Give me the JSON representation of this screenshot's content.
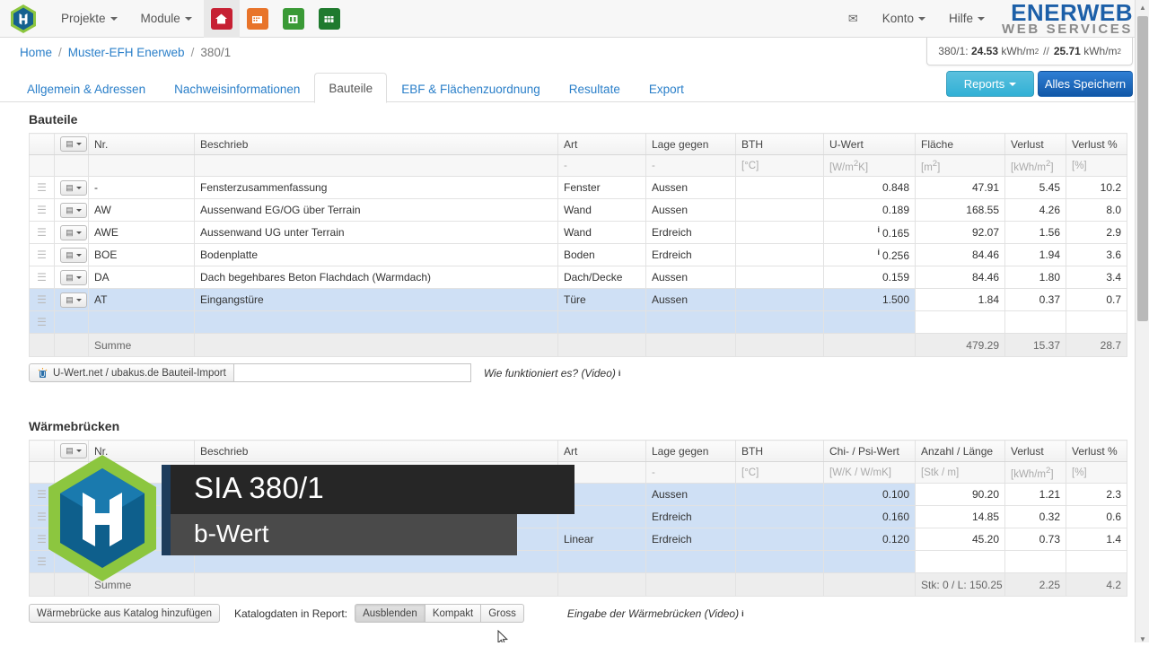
{
  "navbar": {
    "logo_icon": "hexagon-logo-icon",
    "menus": [
      {
        "label": "Projekte",
        "icon": "chevron-down-icon"
      },
      {
        "label": "Module",
        "icon": "chevron-down-icon"
      }
    ],
    "quick_icons": [
      {
        "name": "home-icon",
        "color": "#c62033"
      },
      {
        "name": "building-icon",
        "color": "#e8742a"
      },
      {
        "name": "chart-green-icon",
        "color": "#3a9a36"
      },
      {
        "name": "table-green-icon",
        "color": "#1f7a2e"
      }
    ],
    "mail_icon": "mail-icon",
    "right_menus": [
      {
        "label": "Konto",
        "icon": "chevron-down-icon"
      },
      {
        "label": "Hilfe",
        "icon": "chevron-down-icon"
      }
    ],
    "brand": {
      "line1": "ENERWEB",
      "line2": "WEB SERVICES",
      "color1": "#1c5fa8",
      "color2": "#8a8a8a"
    }
  },
  "breadcrumb": {
    "items": [
      "Home",
      "Muster-EFH Enerweb",
      "380/1"
    ],
    "separator": "/"
  },
  "kpi": {
    "label": "380/1:",
    "value1": "24.53",
    "unit1": "kWh/m",
    "sup1": "2",
    "separator": "//",
    "value2": "25.71",
    "unit2": "kWh/m",
    "sup2": "2"
  },
  "tabs": [
    {
      "label": "Allgemein & Adressen",
      "active": false
    },
    {
      "label": "Nachweisinformationen",
      "active": false
    },
    {
      "label": "Bauteile",
      "active": true
    },
    {
      "label": "EBF & Flächenzuordnung",
      "active": false
    },
    {
      "label": "Resultate",
      "active": false
    },
    {
      "label": "Export",
      "active": false
    }
  ],
  "actions": {
    "reports_label": "Reports",
    "reports_color": "#31b0d5",
    "save_label": "Alles Speichern",
    "save_color": "#1158a8"
  },
  "bauteile": {
    "title": "Bauteile",
    "columns": [
      "",
      "",
      "Nr.",
      "Beschrieb",
      "Art",
      "Lage gegen",
      "BTH",
      "U-Wert",
      "Fläche",
      "Verlust",
      "Verlust %"
    ],
    "units": [
      "",
      "",
      "",
      "",
      "-",
      "-",
      "[°C]",
      "[W/m2K]",
      "[m2]",
      "[kWh/m2]",
      "[%]"
    ],
    "rows": [
      {
        "nr": "-",
        "beschrieb": "Fensterzusammenfassung",
        "art": "Fenster",
        "lage": "Aussen",
        "bth": "",
        "uwert": "0.848",
        "info": false,
        "flaeche": "47.91",
        "verlust": "5.45",
        "verlustp": "10.2",
        "selected": false
      },
      {
        "nr": "AW",
        "beschrieb": "Aussenwand EG/OG über Terrain",
        "art": "Wand",
        "lage": "Aussen",
        "bth": "",
        "uwert": "0.189",
        "info": false,
        "flaeche": "168.55",
        "verlust": "4.26",
        "verlustp": "8.0",
        "selected": false
      },
      {
        "nr": "AWE",
        "beschrieb": "Aussenwand UG unter Terrain",
        "art": "Wand",
        "lage": "Erdreich",
        "bth": "",
        "uwert": "0.165",
        "info": true,
        "flaeche": "92.07",
        "verlust": "1.56",
        "verlustp": "2.9",
        "selected": false
      },
      {
        "nr": "BOE",
        "beschrieb": "Bodenplatte",
        "art": "Boden",
        "lage": "Erdreich",
        "bth": "",
        "uwert": "0.256",
        "info": true,
        "flaeche": "84.46",
        "verlust": "1.94",
        "verlustp": "3.6",
        "selected": false
      },
      {
        "nr": "DA",
        "beschrieb": "Dach begehbares Beton Flachdach (Warmdach)",
        "art": "Dach/Decke",
        "lage": "Aussen",
        "bth": "",
        "uwert": "0.159",
        "info": false,
        "flaeche": "84.46",
        "verlust": "1.80",
        "verlustp": "3.4",
        "selected": false
      },
      {
        "nr": "AT",
        "beschrieb": "Eingangstüre",
        "art": "Türe",
        "lage": "Aussen",
        "bth": "",
        "uwert": "1.500",
        "info": false,
        "flaeche": "1.84",
        "verlust": "0.37",
        "verlustp": "0.7",
        "selected": true
      }
    ],
    "summary": {
      "label": "Summe",
      "flaeche": "479.29",
      "verlust": "15.37",
      "verlustp": "28.7"
    },
    "import_button": "U-Wert.net / ubakus.de Bauteil-Import",
    "import_input_value": "",
    "help_text": "Wie funktioniert es? (Video)",
    "help_icon": "info-icon"
  },
  "waermebruecken": {
    "title": "Wärmebrücken",
    "columns": [
      "",
      "",
      "Nr.",
      "Beschrieb",
      "Art",
      "Lage gegen",
      "BTH",
      "Chi- / Psi-Wert",
      "Anzahl / Länge",
      "Verlust",
      "Verlust %"
    ],
    "units": [
      "",
      "",
      "",
      "",
      "-",
      "-",
      "[°C]",
      "[W/K / W/mK]",
      "[Stk / m]",
      "[kWh/m2]",
      "[%]"
    ],
    "rows": [
      {
        "nr": "",
        "beschrieb": "",
        "art": "",
        "lage": "Aussen",
        "bth": "",
        "chipsi": "0.100",
        "anzahl": "90.20",
        "verlust": "1.21",
        "verlustp": "2.3",
        "selected": true
      },
      {
        "nr": "",
        "beschrieb": "",
        "art": "",
        "lage": "Erdreich",
        "bth": "",
        "chipsi": "0.160",
        "anzahl": "14.85",
        "verlust": "0.32",
        "verlustp": "0.6",
        "selected": true
      },
      {
        "nr": "",
        "beschrieb": "",
        "art": "Linear",
        "lage": "Erdreich",
        "bth": "",
        "chipsi": "0.120",
        "anzahl": "45.20",
        "verlust": "0.73",
        "verlustp": "1.4",
        "selected": true
      }
    ],
    "summary": {
      "label": "Summe",
      "anzahl": "Stk: 0 / L: 150.25",
      "verlust": "2.25",
      "verlustp": "4.2"
    },
    "catalog_button": "Wärmebrücke aus Katalog hinzufügen",
    "report_label": "Katalogdaten in Report:",
    "report_options": [
      {
        "label": "Ausblenden",
        "pressed": true
      },
      {
        "label": "Kompakt",
        "pressed": false
      },
      {
        "label": "Gross",
        "pressed": false
      }
    ],
    "help_text": "Eingabe der Wärmebrücken (Video)",
    "help_icon": "info-icon"
  },
  "overlay": {
    "logo_icon": "hexagon-brand-logo-icon",
    "title": "SIA 380/1",
    "subtitle": "b-Wert",
    "title_bg": "#262626",
    "subtitle_bg": "#4a4a4a",
    "accent_bar": "#1d3c5c"
  },
  "scrollbar": {
    "up_icon": "triangle-up-icon",
    "down_icon": "triangle-down-icon",
    "thumb": "scroll-thumb"
  },
  "cursor": {
    "icon": "mouse-pointer-icon"
  }
}
